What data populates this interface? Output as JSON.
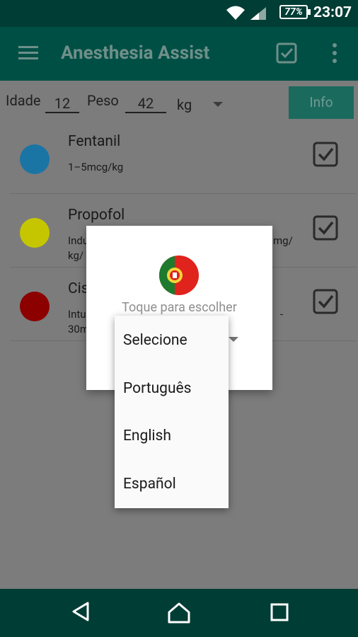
{
  "status_bar": {
    "battery": "77%",
    "time": "23:07",
    "wifi_icon": "wifi-icon",
    "signal_icon": "signal-icon"
  },
  "app_bar": {
    "title": "Anesthesia Assist",
    "menu_icon": "menu-icon",
    "check_icon": "check-icon",
    "more_icon": "more-vert-icon",
    "color": "#004f45"
  },
  "inputs": {
    "age_label": "Idade",
    "age_value": "12",
    "weight_label": "Peso",
    "weight_value": "42",
    "unit_value": "kg",
    "info_button": "Info"
  },
  "drugs": [
    {
      "name": "Fentanil",
      "dose_line1": "1–5mcg/kg",
      "dose_line2": "",
      "color": "#1b75a4",
      "checked": true
    },
    {
      "name": "Propofol",
      "dose_line1": "Indu",
      "dose_line1_right": "mg/",
      "dose_line2": "kg/",
      "color": "#c6c600",
      "checked": true
    },
    {
      "name": "Cis",
      "dose_line1": "Intu",
      "dose_line1_right": "-",
      "dose_line2": "30m",
      "color": "#8c0000",
      "checked": true
    }
  ],
  "dialog": {
    "flag_icon": "portugal-flag-icon",
    "hint": "Toque para escolher"
  },
  "dropdown": {
    "options": [
      "Selecione",
      "Português",
      "English",
      "Español"
    ]
  },
  "nav_bar": {
    "back_icon": "back-icon",
    "home_icon": "home-icon",
    "recents_icon": "recents-icon"
  }
}
